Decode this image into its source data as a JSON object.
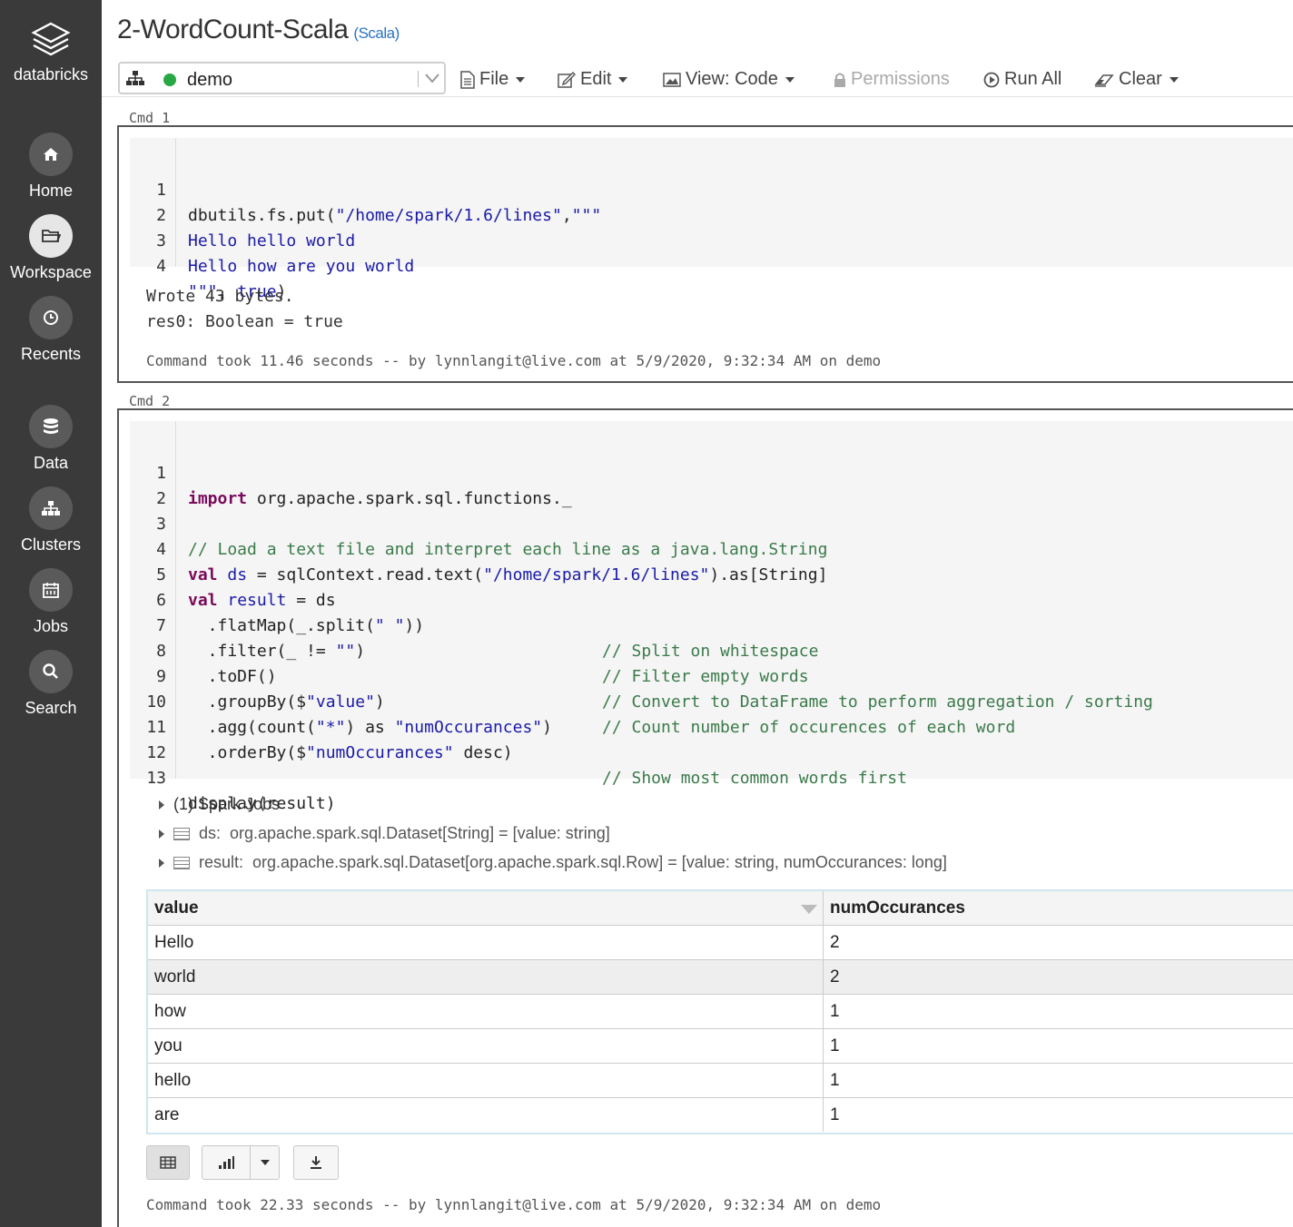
{
  "sidebar": {
    "brand": "databricks",
    "items": [
      {
        "label": "Home",
        "icon": "home-icon"
      },
      {
        "label": "Workspace",
        "icon": "folder-icon"
      },
      {
        "label": "Recents",
        "icon": "clock-icon"
      },
      {
        "label": "Data",
        "icon": "database-icon"
      },
      {
        "label": "Clusters",
        "icon": "cluster-icon"
      },
      {
        "label": "Jobs",
        "icon": "calendar-icon"
      },
      {
        "label": "Search",
        "icon": "search-icon"
      }
    ]
  },
  "header": {
    "title": "2-WordCount-Scala",
    "language": "(Scala)",
    "cluster": "demo",
    "toolbar": {
      "file": "File",
      "edit": "Edit",
      "view": "View: Code",
      "permissions": "Permissions",
      "run_all": "Run All",
      "clear": "Clear"
    }
  },
  "colors": {
    "sidebar_bg": "#3a3a3a",
    "cluster_status": "#28a745",
    "string": "#1a1aa6",
    "keyword": "#7a0a5a",
    "comment": "#3a7a4a"
  },
  "cmd1": {
    "label": "Cmd 1",
    "line_numbers": [
      "1",
      "2",
      "3",
      "4"
    ],
    "code": {
      "l1_a": "dbutils.fs.put(",
      "l1_b": "\"/home/spark/1.6/lines\"",
      "l1_c": ",",
      "l1_d": "\"\"\"",
      "l2": "Hello hello world",
      "l3": "Hello how are you world",
      "l4_a": "\"\"\"",
      "l4_b": ", ",
      "l4_c": "true",
      "l4_d": ")"
    },
    "output": [
      "Wrote 43 bytes.",
      "res0: Boolean = true"
    ],
    "took": "Command took 11.46 seconds -- by lynnlangit@live.com at 5/9/2020, 9:32:34 AM on demo"
  },
  "cmd2": {
    "label": "Cmd 2",
    "line_numbers": [
      "1",
      "2",
      "3",
      "4",
      "5",
      "6",
      "7",
      "8",
      "9",
      "10",
      "11",
      "12",
      "13"
    ],
    "code": {
      "l1_kw": "import",
      "l1_rest": " org.apache.spark.sql.functions._",
      "l3": "// Load a text file and interpret each line as a java.lang.String",
      "l4_kw": "val",
      "l4_var": " ds",
      "l4_a": " = sqlContext.read.text(",
      "l4_str": "\"/home/spark/1.6/lines\"",
      "l4_b": ").as[String]",
      "l5_kw": "val",
      "l5_var": " result",
      "l5_a": " = ds",
      "l6_a": "  .flatMap(_.split(",
      "l6_str": "\" \"",
      "l6_b": "))",
      "l6_cmt": "// Split on whitespace",
      "l7_a": "  .filter(_ != ",
      "l7_str": "\"\"",
      "l7_b": ")",
      "l7_cmt": "// Filter empty words",
      "l8_a": "  .toDF()",
      "l8_cmt": "// Convert to DataFrame to perform aggregation / sorting",
      "l9_a": "  .groupBy($",
      "l9_str": "\"value\"",
      "l9_b": ")",
      "l9_cmt": "// Count number of occurences of each word",
      "l10_a": "  .agg(count(",
      "l10_str": "\"*\"",
      "l10_b": ") as ",
      "l10_str2": "\"numOccurances\"",
      "l10_c": ")",
      "l11_a": "  .orderBy($",
      "l11_str": "\"numOccurances\"",
      "l11_b": " desc)",
      "l11_cmt": "// Show most common words first",
      "l13": "display(result)"
    },
    "spark_jobs": "(1) Spark Jobs",
    "ds_name": "ds:",
    "ds_type": "org.apache.spark.sql.Dataset[String] = [value: string]",
    "result_name": "result:",
    "result_type": "org.apache.spark.sql.Dataset[org.apache.spark.sql.Row] = [value: string, numOccurances: long]",
    "table": {
      "columns": [
        "value",
        "numOccurances"
      ],
      "rows": [
        [
          "Hello",
          "2"
        ],
        [
          "world",
          "2"
        ],
        [
          "how",
          "1"
        ],
        [
          "you",
          "1"
        ],
        [
          "hello",
          "1"
        ],
        [
          "are",
          "1"
        ]
      ]
    },
    "took": "Command took 22.33 seconds -- by lynnlangit@live.com at 5/9/2020, 9:32:34 AM on demo"
  }
}
